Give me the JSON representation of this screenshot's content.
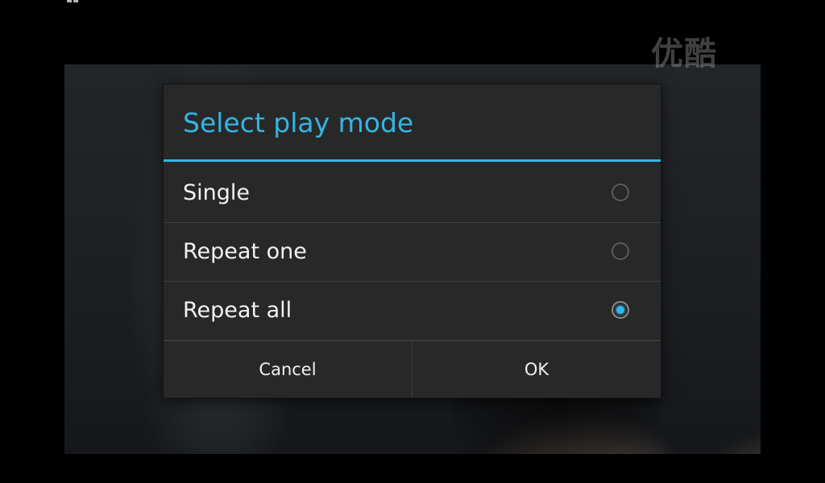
{
  "background": {
    "watermark": "优酷"
  },
  "dialog": {
    "title": "Select play mode",
    "accent_color": "#33b5e5",
    "options": [
      {
        "label": "Single",
        "selected": false
      },
      {
        "label": "Repeat one",
        "selected": false
      },
      {
        "label": "Repeat all",
        "selected": true
      }
    ],
    "buttons": {
      "cancel": "Cancel",
      "ok": "OK"
    }
  }
}
